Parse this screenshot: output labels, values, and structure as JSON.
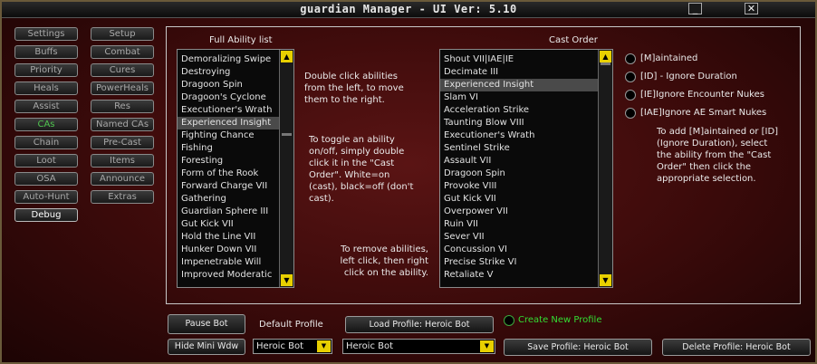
{
  "window": {
    "title": "guardian Manager  - UI Ver: 5.10",
    "minimize_glyph": "_",
    "close_glyph": "✕"
  },
  "nav": {
    "col1": [
      "Settings",
      "Buffs",
      "Priority",
      "Heals",
      "Assist",
      "CAs",
      "Chain",
      "Loot",
      "OSA",
      "Auto-Hunt",
      "Debug"
    ],
    "col2": [
      "Setup",
      "Combat",
      "Cures",
      "PowerHeals",
      "Res",
      "Named CAs",
      "Pre-Cast",
      "Items",
      "Announce",
      "Extras"
    ],
    "active": "CAs"
  },
  "ability_list": {
    "label": "Full Ability list",
    "items": [
      "Demoralizing Swipe",
      "Destroying",
      "Dragoon Spin",
      "Dragoon's Cyclone",
      "Executioner's Wrath",
      "Experienced Insight",
      "Fighting Chance",
      "Fishing",
      "Foresting",
      "Form of the Rook",
      "Forward Charge VII",
      "Gathering",
      "Guardian Sphere III",
      "Gut Kick VII",
      "Hold the Line VII",
      "Hunker Down VII",
      "Impenetrable Will",
      "Improved Moderatic"
    ],
    "selected": "Experienced Insight"
  },
  "cast_order": {
    "label": "Cast Order",
    "items": [
      "Shout VII|IAE|IE",
      "Decimate III",
      "Experienced Insight",
      "Slam VI",
      "Acceleration Strike",
      "Taunting Blow VIII",
      "Executioner's Wrath",
      "Sentinel Strike",
      "Assault VII",
      "Dragoon Spin",
      "Provoke VIII",
      "Gut Kick VII",
      "Overpower VII",
      "Ruin VII",
      "Sever VII",
      "Concussion VI",
      "Precise Strike VI",
      "Retaliate V"
    ],
    "selected": "Experienced Insight"
  },
  "instructions": {
    "move": "Double click abilities from the left, to move them to the right.",
    "toggle": "To toggle an ability on/off, simply double click it in the \"Cast Order\". White=on (cast), black=off (don't cast).",
    "remove": "To remove abilities, left click, then right click on the ability.",
    "add_options": "To add [M]aintained or [ID] (Ignore Duration), select the ability from the \"Cast Order\" then click the appropriate selection."
  },
  "options": [
    "[M]aintained",
    "[ID] - Ignore Duration",
    "[IE]Ignore Encounter Nukes",
    "[IAE]Ignore AE Smart Nukes"
  ],
  "bottom": {
    "pause_label": "Pause Bot",
    "hide_label": "Hide Mini Wdw",
    "default_profile_label": "Default Profile",
    "default_profile_value": "Heroic Bot",
    "profile_select_value": "Heroic Bot",
    "load_label": "Load Profile: Heroic Bot",
    "create_label": "Create New Profile",
    "save_label": "Save Profile: Heroic Bot",
    "delete_label": "Delete Profile: Heroic Bot"
  },
  "colors": {
    "active_nav": "#4fc34f",
    "create_profile": "#33dd33",
    "scroll_arrow": "#e8d000"
  }
}
